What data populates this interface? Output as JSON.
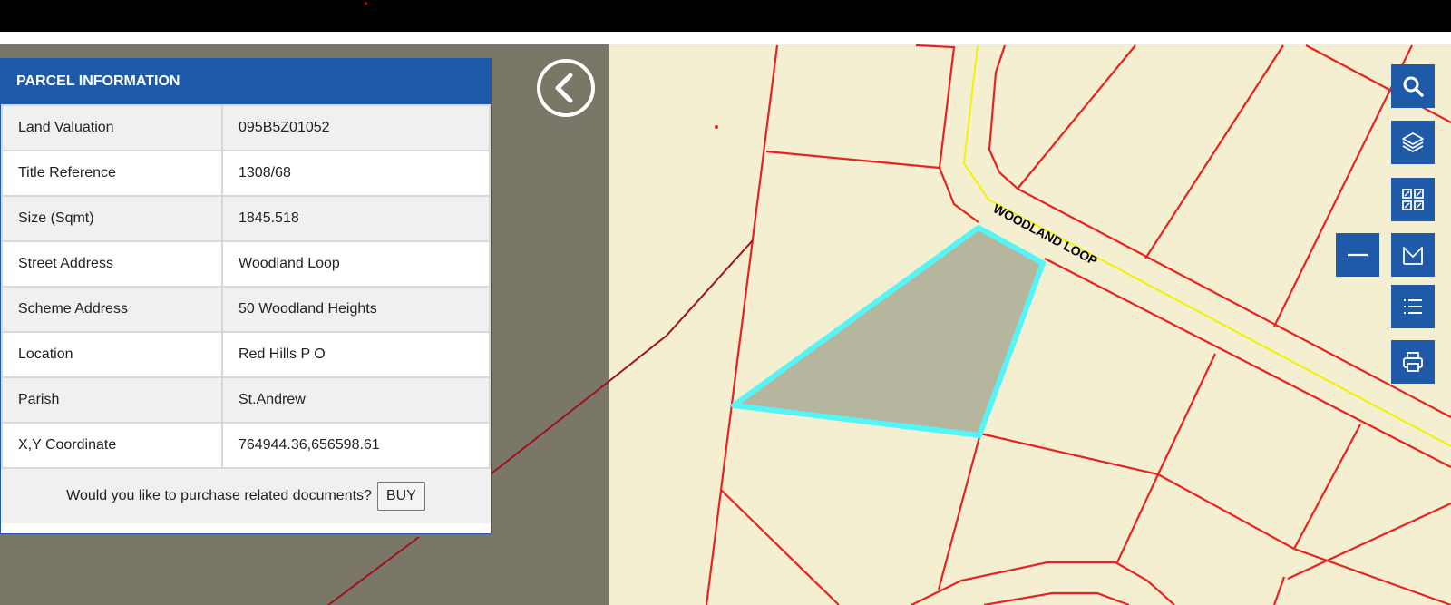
{
  "panel": {
    "title": "PARCEL INFORMATION",
    "rows": [
      {
        "label": "Land Valuation",
        "value": "095B5Z01052"
      },
      {
        "label": "Title Reference",
        "value": "1308/68"
      },
      {
        "label": "Size (Sqmt)",
        "value": "1845.518"
      },
      {
        "label": "Street Address",
        "value": "Woodland Loop"
      },
      {
        "label": "Scheme Address",
        "value": "50 Woodland Heights"
      },
      {
        "label": "Location",
        "value": "Red Hills P O"
      },
      {
        "label": "Parish",
        "value": "St.Andrew"
      },
      {
        "label": "X,Y Coordinate",
        "value": "764944.36,656598.61"
      }
    ],
    "footer_text": "Would you like to purchase related documents?",
    "buy_label": "BUY"
  },
  "map": {
    "road_label": "WOODLAND LOOP",
    "colors": {
      "parcel_fill": "#f3efd0",
      "outside_fill": "#7a7768",
      "parcel_line": "#e8231f",
      "road_centerline": "#f2f200",
      "selected_outline": "#55f5f7",
      "selected_fill": "#b6b59e"
    }
  },
  "toolbar": {
    "accent": "#1e5aa8",
    "tools": [
      "search-icon",
      "layers-icon",
      "basemap-icon",
      "minimize-icon",
      "measure-icon",
      "list-icon",
      "print-icon"
    ]
  }
}
